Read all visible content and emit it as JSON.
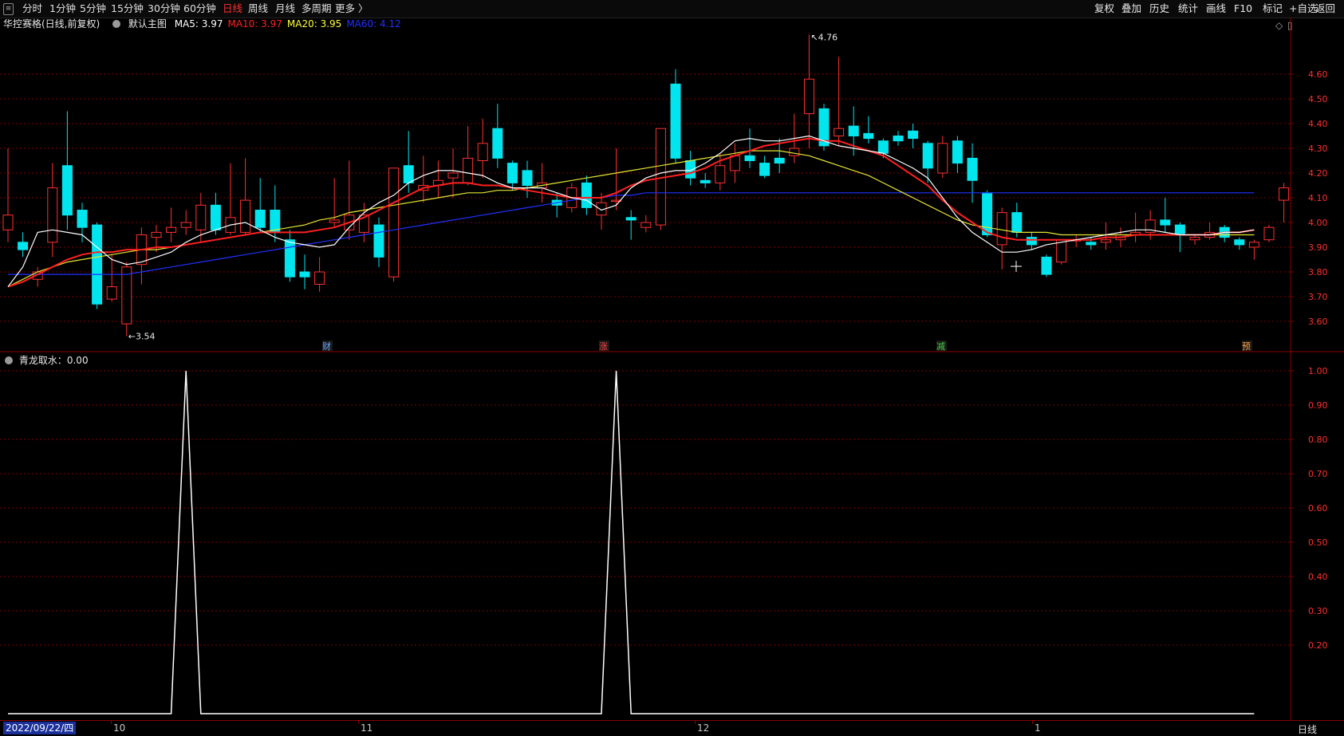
{
  "toolbar": {
    "periods": [
      "分时",
      "1分钟",
      "5分钟",
      "15分钟",
      "30分钟",
      "60分钟",
      "日线",
      "周线",
      "月线",
      "多周期",
      "更多 〉"
    ],
    "active_period": "日线",
    "right_buttons": [
      "复权",
      "叠加",
      "历史",
      "统计",
      "画线",
      "F10",
      "+自选",
      "返回"
    ],
    "right_extra": "标记"
  },
  "main_chart": {
    "title": "华控赛格(日线,前复权)",
    "indicator_name": "默认主图",
    "ma_legend": [
      {
        "label": "MA5: 3.97",
        "color": "#ffffff"
      },
      {
        "label": "MA10: 3.97",
        "color": "#ff2020"
      },
      {
        "label": "MA20: 3.95",
        "color": "#ffff33"
      },
      {
        "label": "MA60: 4.12",
        "color": "#2030ff"
      }
    ],
    "price_axis": [
      "4.60",
      "4.50",
      "4.40",
      "4.30",
      "4.20",
      "4.10",
      "4.00",
      "3.90",
      "3.80",
      "3.70",
      "3.60"
    ],
    "high_annotation": "4.76",
    "low_annotation": "3.54",
    "event_tags": [
      {
        "text": "财",
        "color": "#6aa8ff"
      },
      {
        "text": "涨",
        "color": "#ff4040"
      },
      {
        "text": "减",
        "color": "#40d040"
      },
      {
        "text": "预",
        "color": "#ffa040"
      }
    ]
  },
  "sub_chart": {
    "title": "青龙取水",
    "value": "0.00",
    "axis": [
      "1.00",
      "0.90",
      "0.80",
      "0.70",
      "0.60",
      "0.50",
      "0.40",
      "0.30",
      "0.20"
    ]
  },
  "date_axis": {
    "current_date": "2022/09/22/四",
    "month_ticks": [
      "10",
      "11",
      "12",
      "1"
    ],
    "period_label": "日线"
  },
  "colors": {
    "up": "#ff3030",
    "down": "#00e5ee",
    "grid": "#7a0000",
    "border": "#8b0000"
  },
  "chart_data": {
    "type": "candlestick",
    "ylim": [
      3.54,
      4.76
    ],
    "candles": [
      {
        "o": 3.97,
        "c": 4.03,
        "h": 4.3,
        "l": 3.92
      },
      {
        "o": 3.92,
        "c": 3.89,
        "h": 3.96,
        "l": 3.86
      },
      {
        "o": 3.77,
        "c": 3.8,
        "h": 3.82,
        "l": 3.74
      },
      {
        "o": 3.92,
        "c": 4.14,
        "h": 4.24,
        "l": 3.86
      },
      {
        "o": 4.23,
        "c": 4.03,
        "h": 4.45,
        "l": 3.97
      },
      {
        "o": 4.05,
        "c": 3.98,
        "h": 4.08,
        "l": 3.92
      },
      {
        "o": 3.99,
        "c": 3.67,
        "h": 4.0,
        "l": 3.65
      },
      {
        "o": 3.69,
        "c": 3.74,
        "h": 3.87,
        "l": 3.68
      },
      {
        "o": 3.59,
        "c": 3.82,
        "h": 3.84,
        "l": 3.54
      },
      {
        "o": 3.83,
        "c": 3.95,
        "h": 3.98,
        "l": 3.75
      },
      {
        "o": 3.94,
        "c": 3.96,
        "h": 3.99,
        "l": 3.88
      },
      {
        "o": 3.96,
        "c": 3.98,
        "h": 4.06,
        "l": 3.92
      },
      {
        "o": 3.98,
        "c": 4.0,
        "h": 4.05,
        "l": 3.95
      },
      {
        "o": 3.97,
        "c": 4.07,
        "h": 4.12,
        "l": 3.92
      },
      {
        "o": 4.07,
        "c": 3.97,
        "h": 4.12,
        "l": 3.95
      },
      {
        "o": 3.96,
        "c": 4.02,
        "h": 4.24,
        "l": 3.95
      },
      {
        "o": 3.96,
        "c": 4.09,
        "h": 4.26,
        "l": 3.95
      },
      {
        "o": 4.05,
        "c": 3.98,
        "h": 4.18,
        "l": 3.96
      },
      {
        "o": 4.05,
        "c": 3.96,
        "h": 4.15,
        "l": 3.92
      },
      {
        "o": 3.93,
        "c": 3.78,
        "h": 3.97,
        "l": 3.76
      },
      {
        "o": 3.8,
        "c": 3.78,
        "h": 3.87,
        "l": 3.73
      },
      {
        "o": 3.75,
        "c": 3.8,
        "h": 3.86,
        "l": 3.72
      },
      {
        "o": 4.0,
        "c": 4.01,
        "h": 4.18,
        "l": 3.98
      },
      {
        "o": 3.97,
        "c": 4.03,
        "h": 4.25,
        "l": 3.93
      },
      {
        "o": 3.96,
        "c": 4.03,
        "h": 4.08,
        "l": 3.92
      },
      {
        "o": 3.99,
        "c": 3.86,
        "h": 4.02,
        "l": 3.82
      },
      {
        "o": 3.78,
        "c": 4.22,
        "h": 4.22,
        "l": 3.76
      },
      {
        "o": 4.23,
        "c": 4.16,
        "h": 4.37,
        "l": 4.12
      },
      {
        "o": 4.13,
        "c": 4.15,
        "h": 4.27,
        "l": 4.08
      },
      {
        "o": 4.15,
        "c": 4.17,
        "h": 4.25,
        "l": 4.1
      },
      {
        "o": 4.18,
        "c": 4.2,
        "h": 4.3,
        "l": 4.1
      },
      {
        "o": 4.16,
        "c": 4.26,
        "h": 4.39,
        "l": 4.15
      },
      {
        "o": 4.25,
        "c": 4.32,
        "h": 4.42,
        "l": 4.18
      },
      {
        "o": 4.38,
        "c": 4.26,
        "h": 4.48,
        "l": 4.22
      },
      {
        "o": 4.24,
        "c": 4.16,
        "h": 4.25,
        "l": 4.13
      },
      {
        "o": 4.21,
        "c": 4.15,
        "h": 4.25,
        "l": 4.1
      },
      {
        "o": 4.14,
        "c": 4.16,
        "h": 4.24,
        "l": 4.08
      },
      {
        "o": 4.09,
        "c": 4.07,
        "h": 4.12,
        "l": 4.02
      },
      {
        "o": 4.06,
        "c": 4.14,
        "h": 4.16,
        "l": 4.04
      },
      {
        "o": 4.16,
        "c": 4.06,
        "h": 4.19,
        "l": 4.03
      },
      {
        "o": 4.03,
        "c": 4.08,
        "h": 4.12,
        "l": 3.97
      },
      {
        "o": 4.09,
        "c": 4.09,
        "h": 4.3,
        "l": 4.05
      },
      {
        "o": 4.02,
        "c": 4.01,
        "h": 4.05,
        "l": 3.93
      },
      {
        "o": 3.98,
        "c": 4.0,
        "h": 4.03,
        "l": 3.96
      },
      {
        "o": 3.99,
        "c": 4.38,
        "h": 4.38,
        "l": 3.97
      },
      {
        "o": 4.56,
        "c": 4.26,
        "h": 4.62,
        "l": 4.24
      },
      {
        "o": 4.25,
        "c": 4.18,
        "h": 4.29,
        "l": 4.15
      },
      {
        "o": 4.17,
        "c": 4.16,
        "h": 4.2,
        "l": 4.14
      },
      {
        "o": 4.16,
        "c": 4.23,
        "h": 4.28,
        "l": 4.13
      },
      {
        "o": 4.21,
        "c": 4.27,
        "h": 4.32,
        "l": 4.16
      },
      {
        "o": 4.27,
        "c": 4.25,
        "h": 4.38,
        "l": 4.22
      },
      {
        "o": 4.24,
        "c": 4.19,
        "h": 4.27,
        "l": 4.18
      },
      {
        "o": 4.26,
        "c": 4.24,
        "h": 4.34,
        "l": 4.2
      },
      {
        "o": 4.27,
        "c": 4.3,
        "h": 4.44,
        "l": 4.24
      },
      {
        "o": 4.44,
        "c": 4.58,
        "h": 4.76,
        "l": 4.3
      },
      {
        "o": 4.46,
        "c": 4.31,
        "h": 4.48,
        "l": 4.29
      },
      {
        "o": 4.35,
        "c": 4.38,
        "h": 4.67,
        "l": 4.31
      },
      {
        "o": 4.39,
        "c": 4.35,
        "h": 4.47,
        "l": 4.27
      },
      {
        "o": 4.36,
        "c": 4.34,
        "h": 4.43,
        "l": 4.32
      },
      {
        "o": 4.33,
        "c": 4.28,
        "h": 4.34,
        "l": 4.26
      },
      {
        "o": 4.35,
        "c": 4.33,
        "h": 4.37,
        "l": 4.31
      },
      {
        "o": 4.37,
        "c": 4.34,
        "h": 4.4,
        "l": 4.3
      },
      {
        "o": 4.32,
        "c": 4.22,
        "h": 4.33,
        "l": 4.16
      },
      {
        "o": 4.2,
        "c": 4.32,
        "h": 4.35,
        "l": 4.18
      },
      {
        "o": 4.33,
        "c": 4.24,
        "h": 4.35,
        "l": 4.2
      },
      {
        "o": 4.26,
        "c": 4.17,
        "h": 4.32,
        "l": 4.08
      },
      {
        "o": 4.12,
        "c": 3.95,
        "h": 4.13,
        "l": 3.94
      },
      {
        "o": 3.91,
        "c": 4.04,
        "h": 4.06,
        "l": 3.81
      },
      {
        "o": 4.04,
        "c": 3.96,
        "h": 4.08,
        "l": 3.94
      },
      {
        "o": 3.94,
        "c": 3.91,
        "h": 3.96,
        "l": 3.89
      },
      {
        "o": 3.86,
        "c": 3.79,
        "h": 3.87,
        "l": 3.78
      },
      {
        "o": 3.84,
        "c": 3.93,
        "h": 3.93,
        "l": 3.83
      },
      {
        "o": 3.93,
        "c": 3.93,
        "h": 3.95,
        "l": 3.9
      },
      {
        "o": 3.92,
        "c": 3.91,
        "h": 3.94,
        "l": 3.89
      },
      {
        "o": 3.92,
        "c": 3.93,
        "h": 4.0,
        "l": 3.89
      },
      {
        "o": 3.93,
        "c": 3.95,
        "h": 3.98,
        "l": 3.9
      },
      {
        "o": 3.95,
        "c": 3.96,
        "h": 4.04,
        "l": 3.92
      },
      {
        "o": 3.96,
        "c": 4.01,
        "h": 4.05,
        "l": 3.93
      },
      {
        "o": 4.01,
        "c": 3.99,
        "h": 4.1,
        "l": 3.96
      },
      {
        "o": 3.99,
        "c": 3.95,
        "h": 4.0,
        "l": 3.88
      },
      {
        "o": 3.93,
        "c": 3.94,
        "h": 3.95,
        "l": 3.91
      },
      {
        "o": 3.94,
        "c": 3.96,
        "h": 4.0,
        "l": 3.93
      },
      {
        "o": 3.98,
        "c": 3.94,
        "h": 3.99,
        "l": 3.92
      },
      {
        "o": 3.93,
        "c": 3.91,
        "h": 3.94,
        "l": 3.89
      },
      {
        "o": 3.9,
        "c": 3.92,
        "h": 3.93,
        "l": 3.85
      },
      {
        "o": 3.93,
        "c": 3.98,
        "h": 3.99,
        "l": 3.92
      },
      {
        "o": 4.09,
        "c": 4.14,
        "h": 4.16,
        "l": 4.0
      }
    ],
    "ma5": [
      3.74,
      3.82,
      3.96,
      3.97,
      3.96,
      3.95,
      3.9,
      3.85,
      3.83,
      3.84,
      3.86,
      3.88,
      3.92,
      3.95,
      3.97,
      3.99,
      4.0,
      3.97,
      3.94,
      3.92,
      3.91,
      3.9,
      3.91,
      3.98,
      4.04,
      4.08,
      4.11,
      4.16,
      4.19,
      4.21,
      4.21,
      4.2,
      4.19,
      4.16,
      4.14,
      4.14,
      4.14,
      4.12,
      4.1,
      4.09,
      4.05,
      4.07,
      4.14,
      4.18,
      4.2,
      4.21,
      4.21,
      4.24,
      4.28,
      4.33,
      4.34,
      4.33,
      4.33,
      4.34,
      4.35,
      4.33,
      4.31,
      4.3,
      4.29,
      4.28,
      4.25,
      4.22,
      4.18,
      4.1,
      4.02,
      3.96,
      3.92,
      3.88,
      3.88,
      3.89,
      3.91,
      3.92,
      3.93,
      3.94,
      3.95,
      3.96,
      3.97,
      3.97,
      3.96,
      3.95,
      3.95,
      3.95,
      3.96,
      3.96,
      3.97
    ],
    "ma10": [
      3.74,
      3.76,
      3.79,
      3.82,
      3.85,
      3.87,
      3.88,
      3.88,
      3.89,
      3.89,
      3.9,
      3.9,
      3.91,
      3.92,
      3.93,
      3.94,
      3.95,
      3.96,
      3.96,
      3.96,
      3.96,
      3.97,
      3.98,
      4.0,
      4.02,
      4.05,
      4.08,
      4.11,
      4.14,
      4.15,
      4.16,
      4.16,
      4.15,
      4.15,
      4.14,
      4.13,
      4.12,
      4.11,
      4.1,
      4.1,
      4.1,
      4.12,
      4.15,
      4.17,
      4.18,
      4.19,
      4.2,
      4.22,
      4.25,
      4.27,
      4.29,
      4.31,
      4.32,
      4.33,
      4.34,
      4.33,
      4.33,
      4.31,
      4.29,
      4.27,
      4.23,
      4.19,
      4.15,
      4.09,
      4.04,
      4.0,
      3.96,
      3.94,
      3.93,
      3.93,
      3.93,
      3.93,
      3.93,
      3.93,
      3.94,
      3.94,
      3.95,
      3.95,
      3.95,
      3.95,
      3.95,
      3.95,
      3.96,
      3.96,
      3.97
    ],
    "ma20": [
      3.74,
      3.77,
      3.8,
      3.82,
      3.84,
      3.85,
      3.86,
      3.87,
      3.88,
      3.89,
      3.89,
      3.9,
      3.91,
      3.92,
      3.93,
      3.94,
      3.95,
      3.96,
      3.97,
      3.98,
      3.99,
      4.01,
      4.02,
      4.04,
      4.05,
      4.06,
      4.07,
      4.08,
      4.09,
      4.1,
      4.11,
      4.12,
      4.12,
      4.13,
      4.13,
      4.14,
      4.15,
      4.16,
      4.17,
      4.18,
      4.19,
      4.2,
      4.21,
      4.22,
      4.23,
      4.24,
      4.25,
      4.26,
      4.27,
      4.28,
      4.29,
      4.29,
      4.29,
      4.28,
      4.27,
      4.25,
      4.23,
      4.21,
      4.19,
      4.16,
      4.13,
      4.1,
      4.07,
      4.04,
      4.01,
      3.99,
      3.98,
      3.97,
      3.96,
      3.96,
      3.96,
      3.95,
      3.95,
      3.95,
      3.95,
      3.95,
      3.95,
      3.95,
      3.95,
      3.95,
      3.95,
      3.95,
      3.95,
      3.95,
      3.95
    ],
    "ma60": [
      3.79,
      3.79,
      3.79,
      3.79,
      3.79,
      3.79,
      3.79,
      3.79,
      3.79,
      3.8,
      3.81,
      3.82,
      3.83,
      3.84,
      3.85,
      3.86,
      3.87,
      3.88,
      3.89,
      3.9,
      3.91,
      3.92,
      3.93,
      3.94,
      3.95,
      3.96,
      3.97,
      3.98,
      3.99,
      4.0,
      4.01,
      4.02,
      4.03,
      4.04,
      4.05,
      4.06,
      4.07,
      4.08,
      4.09,
      4.1,
      4.1,
      4.11,
      4.11,
      4.12,
      4.12,
      4.12,
      4.12,
      4.12,
      4.12,
      4.12,
      4.12,
      4.12,
      4.12,
      4.12,
      4.12,
      4.12,
      4.12,
      4.12,
      4.12,
      4.12,
      4.12,
      4.12,
      4.12,
      4.12,
      4.12,
      4.12,
      4.12,
      4.12,
      4.12,
      4.12,
      4.12,
      4.12,
      4.12,
      4.12,
      4.12,
      4.12,
      4.12,
      4.12,
      4.12,
      4.12,
      4.12,
      4.12,
      4.12,
      4.12,
      4.12
    ],
    "signal": {
      "length": 85,
      "peaks": [
        12,
        41
      ],
      "peak_value": 1.0,
      "sub_ylim": [
        0,
        1.0
      ]
    }
  }
}
